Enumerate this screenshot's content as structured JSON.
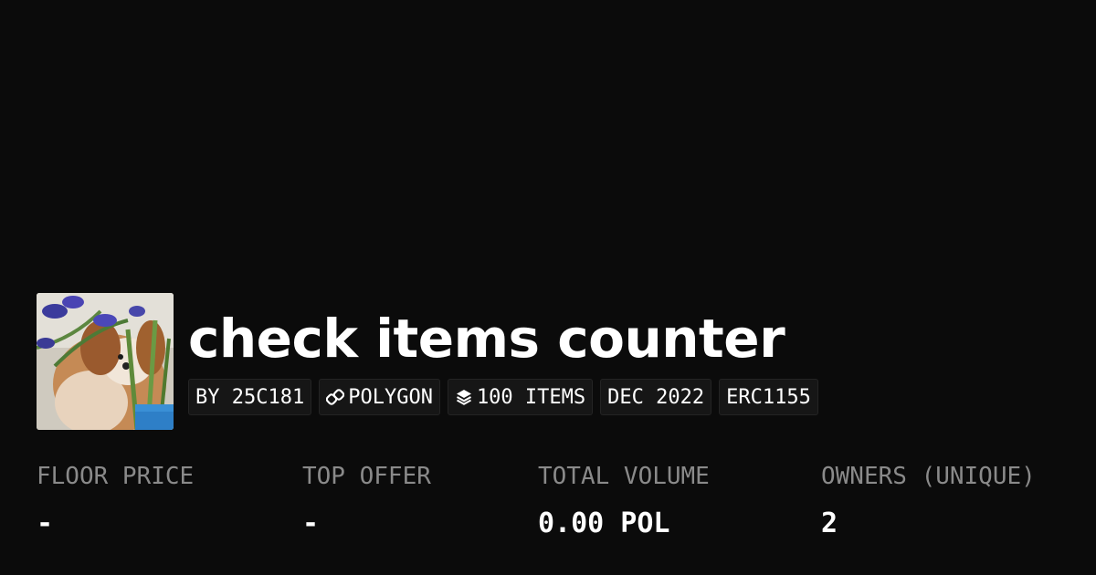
{
  "collection": {
    "title": "check items counter",
    "avatar_icon": "collection-avatar-image"
  },
  "badges": {
    "creator": "BY 25C181",
    "chain": "POLYGON",
    "chain_icon": "chain-link-icon",
    "items": "100 ITEMS",
    "items_icon": "layers-icon",
    "date": "DEC 2022",
    "standard": "ERC1155"
  },
  "stats": {
    "floor_price": {
      "label": "FLOOR PRICE",
      "value": "-"
    },
    "top_offer": {
      "label": "TOP OFFER",
      "value": "-"
    },
    "total_volume": {
      "label": "TOTAL VOLUME",
      "value": "0.00 POL"
    },
    "owners": {
      "label": "OWNERS (UNIQUE)",
      "value": "2"
    }
  },
  "colors": {
    "background": "#0b0b0b",
    "text": "#ffffff",
    "muted_label": "#8a8a8a",
    "badge_bg": "#161616"
  }
}
